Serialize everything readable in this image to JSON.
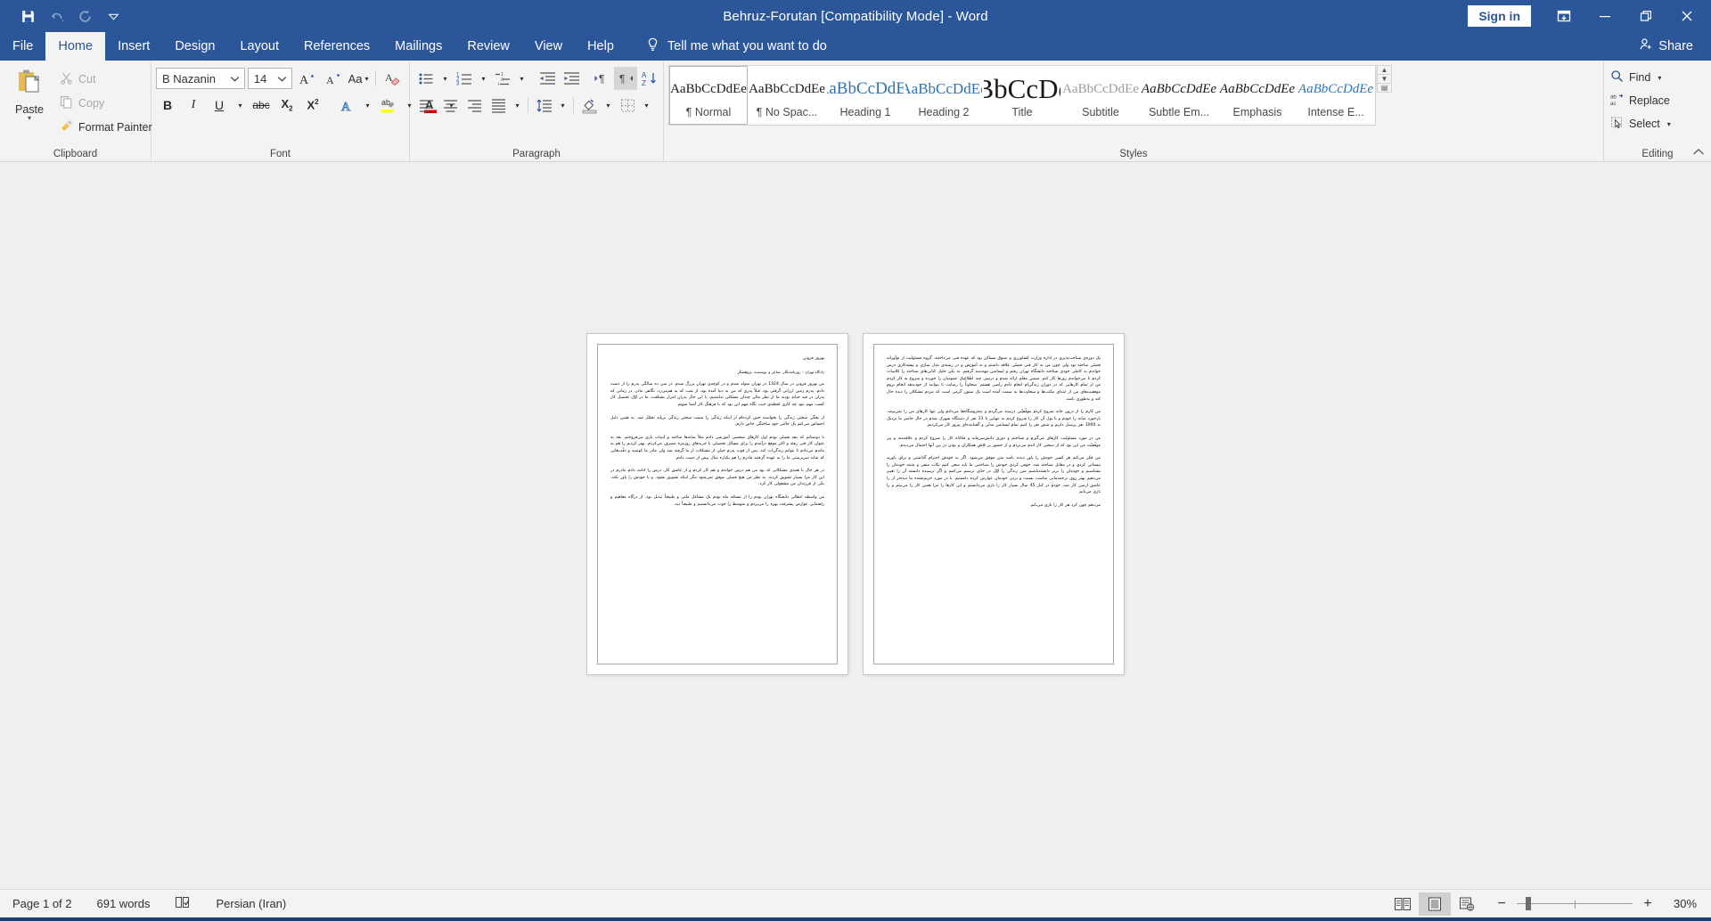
{
  "titlebar": {
    "document_title": "Behruz-Forutan [Compatibility Mode]  -  Word",
    "signin_label": "Sign in",
    "quick_access": [
      {
        "name": "save-icon",
        "label": "Save"
      },
      {
        "name": "undo-icon",
        "label": "Undo"
      },
      {
        "name": "redo-icon",
        "label": "Redo"
      },
      {
        "name": "customize-qat-icon",
        "label": "Customize Quick Access Toolbar"
      }
    ],
    "window_controls": [
      {
        "name": "ribbon-display-options-icon",
        "label": "Ribbon Display Options"
      },
      {
        "name": "minimize-icon",
        "label": "Minimize"
      },
      {
        "name": "restore-icon",
        "label": "Restore Down"
      },
      {
        "name": "close-icon",
        "label": "Close"
      }
    ]
  },
  "tabs": [
    {
      "label": "File",
      "active": false
    },
    {
      "label": "Home",
      "active": true
    },
    {
      "label": "Insert",
      "active": false
    },
    {
      "label": "Design",
      "active": false
    },
    {
      "label": "Layout",
      "active": false
    },
    {
      "label": "References",
      "active": false
    },
    {
      "label": "Mailings",
      "active": false
    },
    {
      "label": "Review",
      "active": false
    },
    {
      "label": "View",
      "active": false
    },
    {
      "label": "Help",
      "active": false
    }
  ],
  "tellme": {
    "label": "Tell me what you want to do"
  },
  "share": {
    "label": "Share"
  },
  "ribbon": {
    "clipboard": {
      "group_label": "Clipboard",
      "paste_label": "Paste",
      "cut_label": "Cut",
      "copy_label": "Copy",
      "format_painter_label": "Format Painter"
    },
    "font": {
      "group_label": "Font",
      "font_name": "B Nazanin",
      "font_size": "14",
      "grow_font_label": "A",
      "shrink_font_label": "A",
      "change_case_label": "Aa",
      "clear_formatting_label": "A",
      "bold_label": "B",
      "italic_label": "I",
      "underline_label": "U",
      "strikethrough_label": "abc",
      "subscript_label": "X",
      "superscript_label": "X",
      "text_effects_label": "A",
      "highlight_label": "ab",
      "font_color_label": "A",
      "font_color_hex": "#d40000",
      "highlight_color_hex": "#ffff00"
    },
    "paragraph": {
      "group_label": "Paragraph",
      "buttons": [
        "bullets",
        "numbering",
        "multilevel-list",
        "decrease-indent",
        "increase-indent",
        "ltr-text-direction",
        "rtl-text-direction",
        "sort",
        "show-formatting-marks",
        "align-left",
        "align-center",
        "align-right",
        "justify",
        "line-spacing",
        "shading",
        "borders"
      ]
    },
    "styles": {
      "group_label": "Styles",
      "items": [
        {
          "preview": "AaBbCcDdEe",
          "name": "¶ Normal",
          "selected": true
        },
        {
          "preview": "AaBbCcDdEe",
          "name": "¶ No Spac...",
          "selected": false
        },
        {
          "preview": "AaBbCcDdEe",
          "name": "Heading 1",
          "selected": false
        },
        {
          "preview": "AaBbCcDdEe",
          "name": "Heading 2",
          "selected": false
        },
        {
          "preview": "AaBbCcDdEe",
          "name": "Title",
          "selected": false
        },
        {
          "preview": "AaBbCcDdEe",
          "name": "Subtitle",
          "selected": false
        },
        {
          "preview": "AaBbCcDdEe",
          "name": "Subtle Em...",
          "selected": false
        },
        {
          "preview": "AaBbCcDdEe",
          "name": "Emphasis",
          "selected": false
        },
        {
          "preview": "AaBbCcDdEe",
          "name": "Intense E...",
          "selected": false
        }
      ]
    },
    "editing": {
      "group_label": "Editing",
      "find_label": "Find",
      "replace_label": "Replace",
      "select_label": "Select"
    }
  },
  "document": {
    "page1": {
      "paragraphs": [
        "بهروز فروتن",
        "زادگاه:تهران - روزنامه‌نگار، شاعر و نویسنده، پژوهشگر",
        "من بهروز فروتن در سال 1324 در تهران متولد شدم و در کوچه‌ی تهران بزرگ شدم. در سن ده سالگی پدرم را از دست دادم. پدرم زمین ارزانی گرفتی بود. قبلاً پدری که من به دنیا آمده بود، از شب که به هم‌می‌زد، نگاهی مادر، در زمانی که پدران در قید حیاته بودند ما از نظر مالی چندان مشکلی نداشتیم، با این حال پدران امرار بشتافت، ما در اوّل تحصیل کار کسب مهم نبود چه کاری لحظه‌ی حیب نگاه مهم این بود که با فرهنگ کار آشنا شویم.",
        "از بچگی سختی زندگی را نخواسته حس کرده‌ام از اینکه زندگی را سمت سختی زندگی بر‌پاید تحمّل شد. به همین دلیل احساس می‌کنم یک حالتی خود ساختگی خاص دارم.",
        "با دوستانم که بچه فصلی بودم اول کارهای شخصی آموزشی دادم مثلاً شانه‌ها ساخته و لبنیات بازی می‌فروختم. بعد به عنوان کار فنی رفته و اکثر موقع درآمدم را برای مسائل تحصیلی با خریدهای روزمره مصرف می‌کردم. بهتر کردیم را هم به ماندم می‌دادم تا بتوانم زندگی‌ات کند. پس از فوت پدرم خیلی از مشکلات از ما گرفته شد ولی مادر ما کوشید و دقّت‌هایی که شاید سرپرستی ما را به عهده گرفتند مادرم را هم یکباره سال پیش از دست دادم.",
        "در هر حال با همه‌ی مشکلاتی که بود من هم درس خواندم و هم کار کردم و از عاشق کار، درس را ادامه دادم مادرم در این کار مرا بسیار تشویق کردند. به نظر من هیچ فصلی موفق نمی‌شود مگر اینکه تشویق بشود. و یا خودش را باور نکند. یکی از فرزندان من مشغولی کار کرد.",
        "من واسطه انتقالی دانشگاه تهران بودم را از مسئله ماه بودم یک مشاغل ملتی و طبیعتاً تبدیل بود. از درگاه مفاهیم و راهنمایی عوارض پیشرفت بهره را می‌پردم و متوسط را خوب می‌دانستیم و طبیعتاً دید."
      ]
    },
    "page2": {
      "paragraphs": [
        "یک دوره‌ی شناخت‌پذیری در اداره وزارت کشاورزی و صنوق مساکن بود که عهده فنی می‌داختند. گروه مسئولیت از نوآورانه فصلی ساخته بود ولی چون من به کار فنی فصلی علاقه داشتم و به آموزش و در رشته‌ی مدل سازی و پیشه‌کاری درس خواندم به کاملی خودی شناخته دانشگاه تهران رفتم و لیسانس مهندسه گرفتم، به یکی خلیل کتابی‌های شناخته را کلاسات کردم تا می‌خواندم روزها کار کنم. سپس معلم ارائه شدم و درسی چند اطلاع‌یک عمومیان را خورده و شروع به کار کردم من از تمام کارهایی که در دوران زندگی‌ام انجام دادم راضی هستم. سخاوتاً را رضایت تا بتوانند از خودبدهد انجام بروم موفقیت‌های من از ابتدای مکتب‌ها و سخاوت‌ها به سمت آمده است یک ستون گرمی است که مردم مشکلان را دیده حال کند و به‌طوری باشد.",
        "من کارم را از درون خانه شروع کردم موفّقیّتی درسته می‌گردم و به‌فروشگاه‌ها می‌دادم ولی تنها کارهای من را نمی‌بینند. بارخورد شانه را خودم و با پول آن کار را شروع کردم به تنهایی تا 11 نفر از دستگاه شهرک شدم در حال حاضر ما نزدیک به 1000 نفر پرسنل داریم و شش نفر را کنیم تمام لیسانس مدلی و گشاینده‌ای پیروز کار می‌کردیم.",
        "من در مورد مسئولیت کارهای می‌گیرم و شناختم و دوری دانش‌سرمایه و فکاناه کار را شروع کردم و علاقه‌مند و پیر موفّقیّت من این بود که از سختی کار اندم می‌بردم و از حضور بر تلاش همکاران و بودن در بین آنها احتمال می‌دیدم.",
        "من فکر می‌کنم هر کسی خودش را باور دیدند باشد متن موفق می‌شود. اگر به خودش احترام گذاشتی و برای باورید نیستانی کردی و در مقابل شناخته شد، خوفی کردی خودش را شناختیی ما باید سعی کنیم نکات منفی و مثبته خودمان را بشناسیم و خودمان را برتر دانشته‌باشیم متن زندگی را اوّل در جدّی ترسیم می‌کنیم و اگر ترسیده دانسته آن را تغییر می‌دهیم بهتر روی ترجمه‌مانی مناسب نسبت و بردن خودمان عوارض کرده دانستیم. با در مورد حریم‌نشده ما دیده‌تر از را عاشق ارمین کار شد. خودم در کنار 45 سال بسیار کار را بازی می‌دانستم و این کارها را مرا همین کار را می‌بینم و را بازی می‌یابم.",
        "می‌دهم چون کرد هر کار را بازی می‌یابم."
      ]
    }
  },
  "statusbar": {
    "page_indicator": "Page 1 of 2",
    "word_count": "691 words",
    "proofing_label": "Proofing errors",
    "language": "Persian (Iran)",
    "views": [
      {
        "name": "read-mode-icon",
        "label": "Read Mode",
        "active": false
      },
      {
        "name": "print-layout-icon",
        "label": "Print Layout",
        "active": true
      },
      {
        "name": "web-layout-icon",
        "label": "Web Layout",
        "active": false
      }
    ],
    "zoom_out_label": "−",
    "zoom_in_label": "+",
    "zoom_percent": "30%"
  }
}
